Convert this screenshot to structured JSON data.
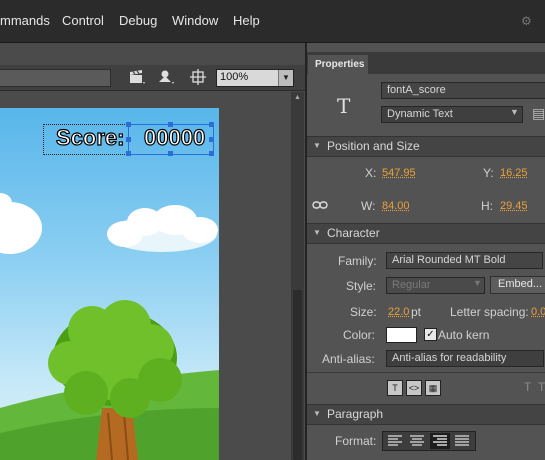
{
  "menu": {
    "items": [
      "mmands",
      "Control",
      "Debug",
      "Window",
      "Help"
    ]
  },
  "stage": {
    "zoom": "100%",
    "score_label": "Score:",
    "score_value": "00000"
  },
  "properties": {
    "tab_label": "Properties",
    "instance_name": "fontA_score",
    "text_type": "Dynamic Text",
    "position_size": {
      "title": "Position and Size",
      "x_label": "X:",
      "x_value": "547.95",
      "y_label": "Y:",
      "y_value": "16.25",
      "w_label": "W:",
      "w_value": "84.00",
      "h_label": "H:",
      "h_value": "29.45"
    },
    "character": {
      "title": "Character",
      "family_label": "Family:",
      "family_value": "Arial Rounded MT Bold",
      "style_label": "Style:",
      "style_value": "Regular",
      "embed_label": "Embed...",
      "size_label": "Size:",
      "size_value": "22.0",
      "size_unit": "pt",
      "letter_spacing_label": "Letter spacing:",
      "letter_spacing_value": "0.0",
      "color_label": "Color:",
      "color_value": "#ffffff",
      "auto_kern_label": "Auto kern",
      "antialias_label": "Anti-alias:",
      "antialias_value": "Anti-alias for readability"
    },
    "paragraph": {
      "title": "Paragraph",
      "format_label": "Format:"
    }
  },
  "colors": {
    "accent_value": "#e9a23b",
    "selection": "#2b6fd6"
  }
}
